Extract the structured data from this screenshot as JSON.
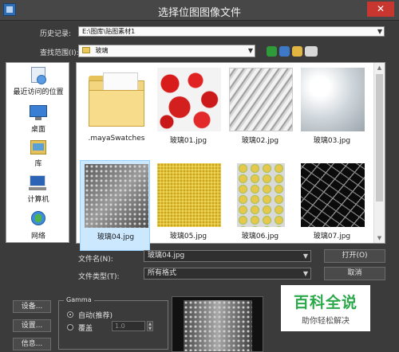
{
  "window": {
    "title": "选择位图图像文件",
    "close": "✕"
  },
  "history": {
    "label": "历史记录:",
    "value": "E:\\图库\\贴图素材1"
  },
  "lookin": {
    "label": "查找范围(I):",
    "value": "玻璃"
  },
  "places": [
    {
      "label": "最近访问的位置",
      "icon": "recent-places-icon"
    },
    {
      "label": "桌面",
      "icon": "desktop-icon"
    },
    {
      "label": "库",
      "icon": "libraries-icon"
    },
    {
      "label": "计算机",
      "icon": "computer-icon"
    },
    {
      "label": "网络",
      "icon": "network-icon"
    }
  ],
  "files": [
    {
      "name": ".mayaSwatches",
      "kind": "folder"
    },
    {
      "name": "玻璃01.jpg",
      "kind": "red-spots"
    },
    {
      "name": "玻璃02.jpg",
      "kind": "silver-streaks"
    },
    {
      "name": "玻璃03.jpg",
      "kind": "frosted"
    },
    {
      "name": "玻璃04.jpg",
      "kind": "hex-glass",
      "selected": true
    },
    {
      "name": "玻璃05.jpg",
      "kind": "yellow-grain"
    },
    {
      "name": "玻璃06.jpg",
      "kind": "circles"
    },
    {
      "name": "玻璃07.jpg",
      "kind": "cracked"
    }
  ],
  "filename": {
    "label": "文件名(N):",
    "value": "玻璃04.jpg"
  },
  "filetype": {
    "label": "文件类型(T):",
    "value": "所有格式"
  },
  "buttons": {
    "open": "打开(O)",
    "cancel": "取消",
    "devices": "设备...",
    "setup": "设置...",
    "info": "信息..."
  },
  "gamma": {
    "title": "Gamma",
    "auto": "自动(推荐)",
    "override": "覆盖",
    "override_value": "1.0"
  },
  "watermark": {
    "main": "百科全说",
    "sub": "助你轻松解决"
  }
}
